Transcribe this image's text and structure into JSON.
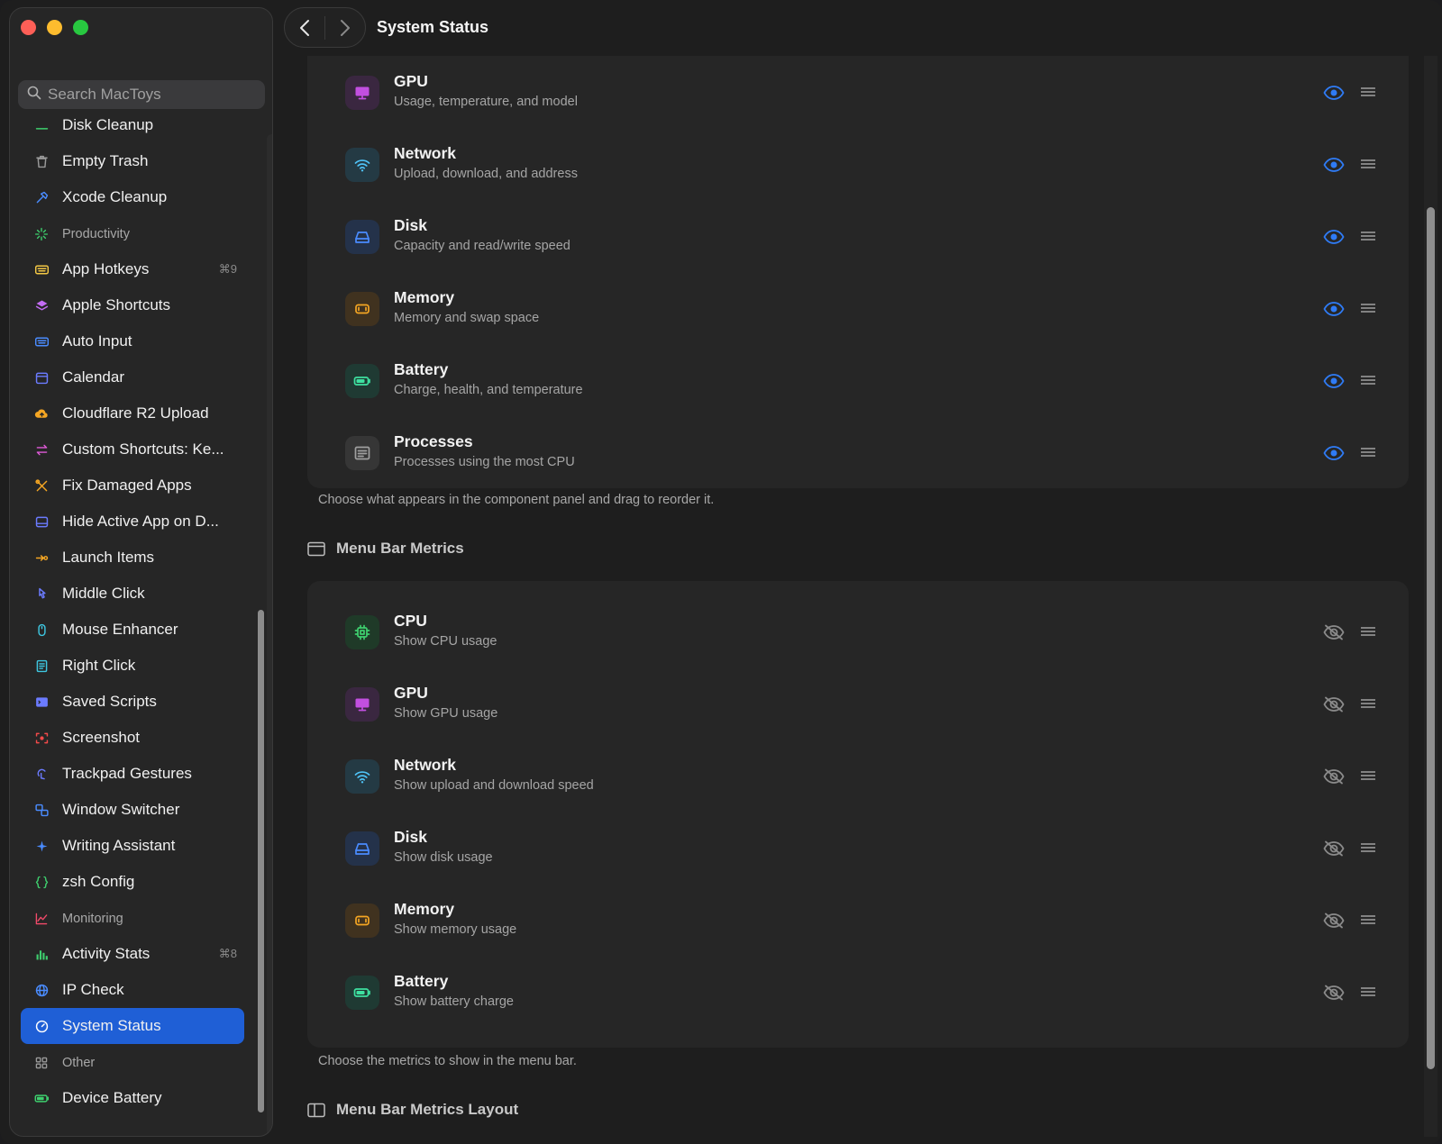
{
  "search": {
    "placeholder": "Search MacToys"
  },
  "toolbar": {
    "title": "System Status"
  },
  "sidebar": {
    "items": [
      {
        "label": "Disk Cleanup",
        "icon": "broom-icon",
        "color": "#3ecf6e"
      },
      {
        "label": "Empty Trash",
        "icon": "trash-icon",
        "color": "#9a9a9a"
      },
      {
        "label": "Xcode Cleanup",
        "icon": "hammer-icon",
        "color": "#4a8cff"
      },
      {
        "label": "Productivity",
        "icon": "sparkle-icon",
        "color": "#3ecf6e",
        "group": true
      },
      {
        "label": "App Hotkeys",
        "icon": "keyboard-icon",
        "color": "#f2c744",
        "shortcut": "⌘9"
      },
      {
        "label": "Apple Shortcuts",
        "icon": "layers-icon",
        "color": "#c46cf5"
      },
      {
        "label": "Auto Input",
        "icon": "keyboard-icon",
        "color": "#4a8cff"
      },
      {
        "label": "Calendar",
        "icon": "calendar-icon",
        "color": "#6b7bff"
      },
      {
        "label": "Cloudflare R2 Upload",
        "icon": "cloud-upload-icon",
        "color": "#f5a623"
      },
      {
        "label": "Custom Shortcuts: Ke...",
        "icon": "arrows-icon",
        "color": "#e05ad8"
      },
      {
        "label": "Fix Damaged Apps",
        "icon": "tools-icon",
        "color": "#f5a623"
      },
      {
        "label": "Hide Active App on D...",
        "icon": "window-icon",
        "color": "#6b7bff"
      },
      {
        "label": "Launch Items",
        "icon": "launch-icon",
        "color": "#f5a623"
      },
      {
        "label": "Middle Click",
        "icon": "pointer-icon",
        "color": "#6b7bff"
      },
      {
        "label": "Mouse Enhancer",
        "icon": "mouse-icon",
        "color": "#3ec6e0"
      },
      {
        "label": "Right Click",
        "icon": "menu-icon",
        "color": "#3ec6e0"
      },
      {
        "label": "Saved Scripts",
        "icon": "terminal-icon",
        "color": "#6b7bff"
      },
      {
        "label": "Screenshot",
        "icon": "camera-icon",
        "color": "#f24a4a"
      },
      {
        "label": "Trackpad Gestures",
        "icon": "gesture-icon",
        "color": "#6b7bff"
      },
      {
        "label": "Window Switcher",
        "icon": "switcher-icon",
        "color": "#4a8cff"
      },
      {
        "label": "Writing Assistant",
        "icon": "sparkles-icon",
        "color": "#4a8cff"
      },
      {
        "label": "zsh Config",
        "icon": "braces-icon",
        "color": "#3ecf6e"
      },
      {
        "label": "Monitoring",
        "icon": "chart-icon",
        "color": "#f24a6a",
        "group": true
      },
      {
        "label": "Activity Stats",
        "icon": "bars-icon",
        "color": "#3ecf6e",
        "shortcut": "⌘8"
      },
      {
        "label": "IP Check",
        "icon": "globe-icon",
        "color": "#4a8cff"
      },
      {
        "label": "System Status",
        "icon": "gauge-icon",
        "color": "#ffffff",
        "active": true
      },
      {
        "label": "Other",
        "icon": "grid-icon",
        "color": "#9a9a9a",
        "group": true
      },
      {
        "label": "Device Battery",
        "icon": "battery-icon",
        "color": "#3ecf6e"
      }
    ]
  },
  "panel": {
    "rows": [
      {
        "name": "GPU",
        "desc": "Usage, temperature, and model",
        "icon": "display-icon",
        "color": "#c24fe0",
        "bg": "#3a2740",
        "visible": true
      },
      {
        "name": "Network",
        "desc": "Upload, download, and address",
        "icon": "wifi-icon",
        "color": "#4fc3f7",
        "bg": "#243a44",
        "visible": true
      },
      {
        "name": "Disk",
        "desc": "Capacity and read/write speed",
        "icon": "drive-icon",
        "color": "#4a8cff",
        "bg": "#24324a",
        "visible": true
      },
      {
        "name": "Memory",
        "desc": "Memory and swap space",
        "icon": "memory-icon",
        "color": "#f5a623",
        "bg": "#40321f",
        "visible": true
      },
      {
        "name": "Battery",
        "desc": "Charge, health, and temperature",
        "icon": "battery-icon",
        "color": "#3ee0a0",
        "bg": "#1f3a33",
        "visible": true
      },
      {
        "name": "Processes",
        "desc": "Processes using the most CPU",
        "icon": "list-icon",
        "color": "#a0a0a0",
        "bg": "#363636",
        "visible": true
      }
    ],
    "caption": "Choose what appears in the component panel and drag to reorder it."
  },
  "menubar": {
    "title": "Menu Bar Metrics",
    "rows": [
      {
        "name": "CPU",
        "desc": "Show CPU usage",
        "icon": "chip-icon",
        "color": "#3ecf6e",
        "bg": "#1f3a28",
        "visible": false
      },
      {
        "name": "GPU",
        "desc": "Show GPU usage",
        "icon": "display-icon",
        "color": "#c24fe0",
        "bg": "#3a2740",
        "visible": false
      },
      {
        "name": "Network",
        "desc": "Show upload and download speed",
        "icon": "wifi-icon",
        "color": "#4fc3f7",
        "bg": "#243a44",
        "visible": false
      },
      {
        "name": "Disk",
        "desc": "Show disk usage",
        "icon": "drive-icon",
        "color": "#4a8cff",
        "bg": "#24324a",
        "visible": false
      },
      {
        "name": "Memory",
        "desc": "Show memory usage",
        "icon": "memory-icon",
        "color": "#f5a623",
        "bg": "#40321f",
        "visible": false
      },
      {
        "name": "Battery",
        "desc": "Show battery charge",
        "icon": "battery-icon",
        "color": "#3ee0a0",
        "bg": "#1f3a33",
        "visible": false
      }
    ],
    "caption": "Choose the metrics to show in the menu bar."
  },
  "layout_section": {
    "title": "Menu Bar Metrics Layout"
  },
  "colors": {
    "accent": "#1f5fd6",
    "eye_on": "#2f7bf5",
    "eye_off": "#8a8a8a"
  }
}
